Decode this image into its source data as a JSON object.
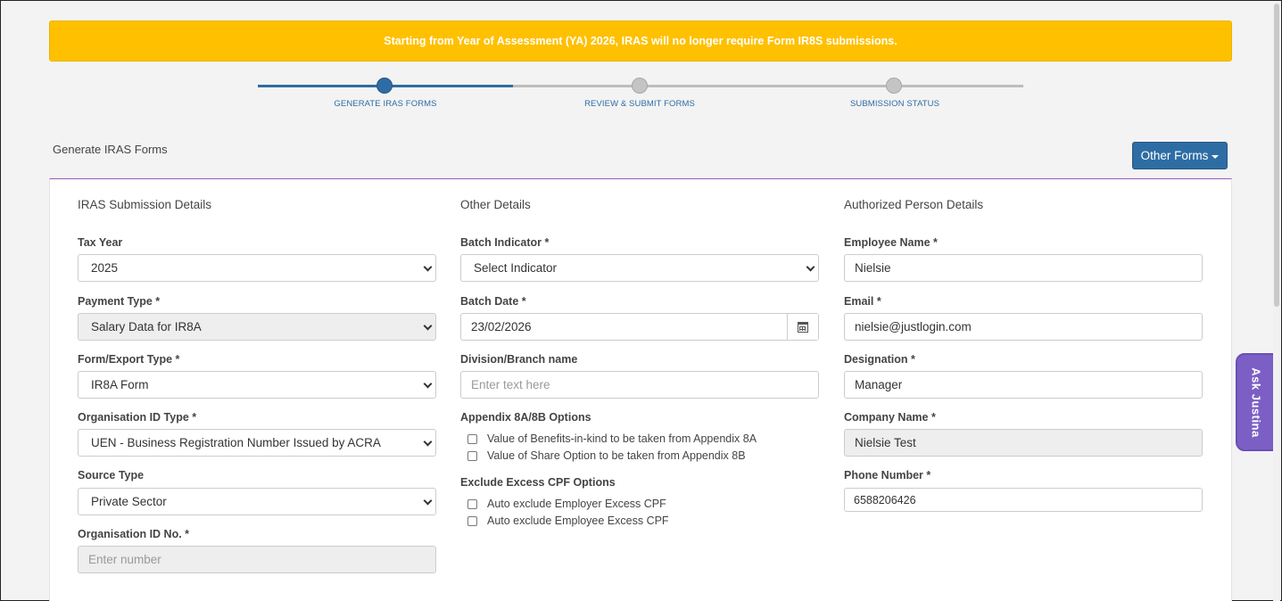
{
  "notice": "Starting from Year of Assessment (YA) 2026, IRAS will no longer require Form IR8S submissions.",
  "stepper": {
    "steps": [
      "GENERATE IRAS FORMS",
      "REVIEW & SUBMIT FORMS",
      "SUBMISSION STATUS"
    ],
    "active_step": 1
  },
  "page_title": "Generate IRAS Forms",
  "other_forms_label": "Other Forms",
  "col1": {
    "title": "IRAS Submission Details",
    "tax_year_label": "Tax Year",
    "tax_year_value": "2025",
    "payment_type_label": "Payment Type *",
    "payment_type_value": "Salary Data for IR8A",
    "form_export_label": "Form/Export Type *",
    "form_export_value": "IR8A Form",
    "org_id_type_label": "Organisation ID Type *",
    "org_id_type_value": "UEN - Business Registration Number Issued by ACRA",
    "source_type_label": "Source Type",
    "source_type_value": "Private Sector",
    "org_id_no_label": "Organisation ID No. *",
    "org_id_no_placeholder": "Enter number"
  },
  "col2": {
    "title": "Other Details",
    "batch_indicator_label": "Batch Indicator *",
    "batch_indicator_value": "Select Indicator",
    "batch_date_label": "Batch Date *",
    "batch_date_value": "23/02/2026",
    "division_label": "Division/Branch name",
    "division_placeholder": "Enter text here",
    "appendix_label": "Appendix 8A/8B Options",
    "appendix_options": [
      "Value of Benefits-in-kind to be taken from Appendix 8A",
      "Value of Share Option to be taken from Appendix 8B"
    ],
    "cpf_label": "Exclude Excess CPF Options",
    "cpf_options": [
      "Auto exclude Employer Excess CPF",
      "Auto exclude Employee Excess CPF"
    ]
  },
  "col3": {
    "title": "Authorized Person Details",
    "employee_name_label": "Employee Name *",
    "employee_name_value": "Nielsie",
    "email_label": "Email *",
    "email_value": "nielsie@justlogin.com",
    "designation_label": "Designation *",
    "designation_value": "Manager",
    "company_name_label": "Company Name *",
    "company_name_value": "Nielsie Test",
    "phone_label": "Phone Number *",
    "phone_value": "6588206426"
  },
  "ask_widget": "Ask Justina",
  "colors": {
    "primary": "#2e6da4",
    "notice": "#ffc000",
    "ask": "#7b5fc4",
    "panel_accent": "#9b59b6"
  }
}
